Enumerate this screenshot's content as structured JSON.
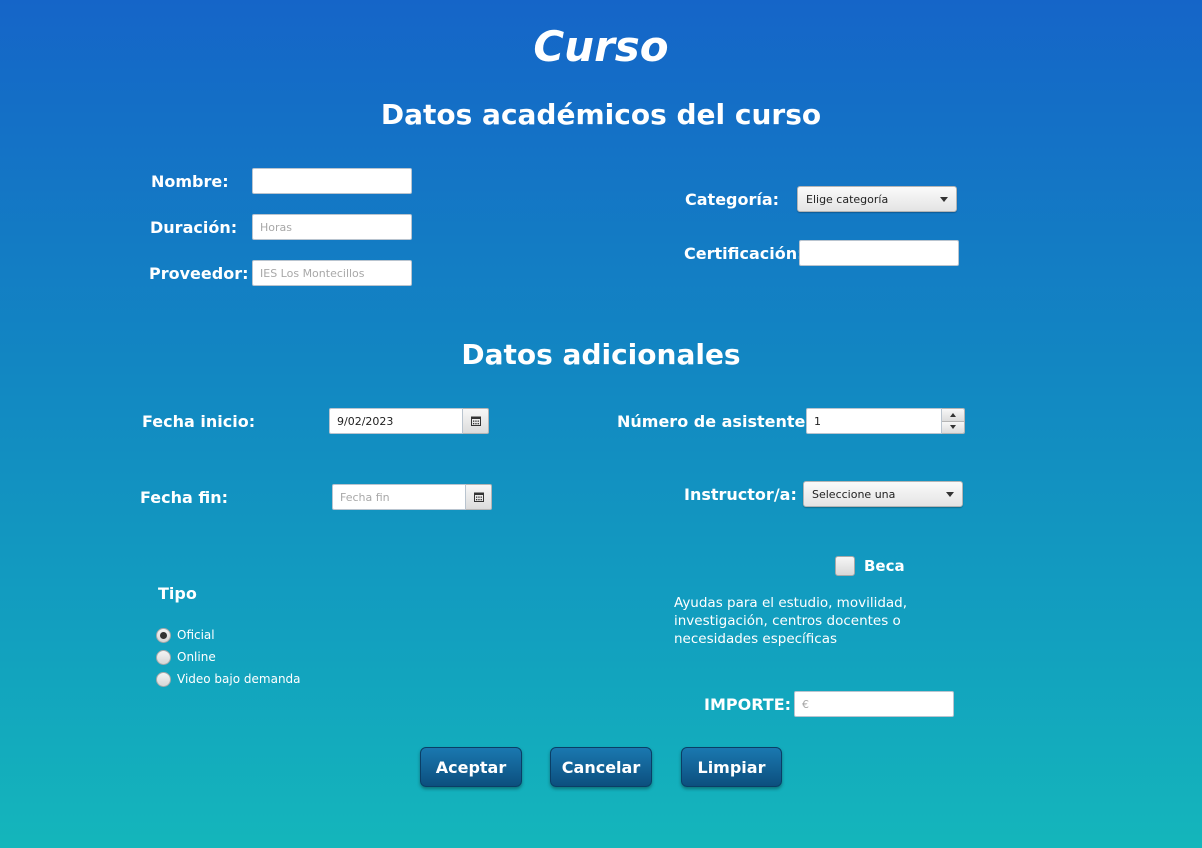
{
  "title": "Curso",
  "section_academic": "Datos académicos del curso",
  "section_additional": "Datos adicionales",
  "academic": {
    "nombre_label": "Nombre:",
    "nombre_value": "",
    "duracion_label": "Duración:",
    "duracion_placeholder": "Horas",
    "proveedor_label": "Proveedor:",
    "proveedor_placeholder": "IES Los Montecillos",
    "categoria_label": "Categoría:",
    "categoria_selected": "Elige categoría",
    "certificacion_label": "Certificación:",
    "certificacion_value": ""
  },
  "additional": {
    "fecha_inicio_label": "Fecha inicio:",
    "fecha_inicio_value": "9/02/2023",
    "fecha_fin_label": "Fecha fin:",
    "fecha_fin_placeholder": "Fecha fin",
    "asistentes_label": "Número de asistentes:",
    "asistentes_value": "1",
    "instructor_label": "Instructor/a:",
    "instructor_selected": "Seleccione una",
    "tipo_label": "Tipo",
    "tipo_options": [
      {
        "label": "Oficial",
        "selected": true
      },
      {
        "label": "Online",
        "selected": false
      },
      {
        "label": "Video bajo demanda",
        "selected": false
      }
    ],
    "beca_label": "Beca",
    "beca_checked": false,
    "beca_description": "Ayudas para el estudio, movilidad, investigación, centros docentes o necesidades específicas",
    "importe_label": "IMPORTE:",
    "importe_placeholder": "€"
  },
  "buttons": {
    "aceptar": "Aceptar",
    "cancelar": "Cancelar",
    "limpiar": "Limpiar"
  },
  "icons": {
    "calendar": "calendar-icon",
    "dropdown": "chevron-down-icon"
  }
}
